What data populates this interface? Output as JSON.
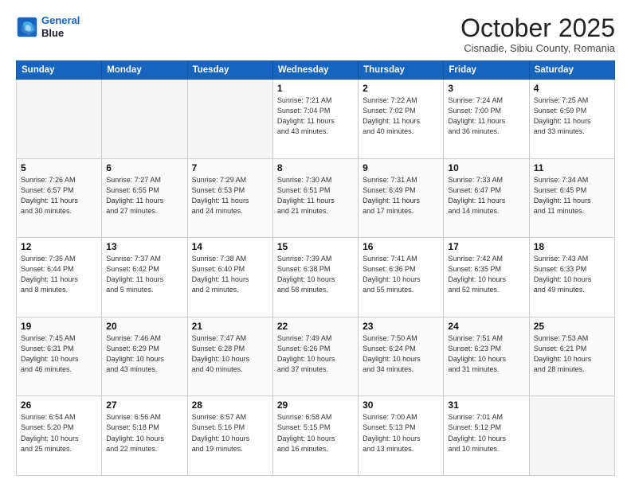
{
  "header": {
    "logo_line1": "General",
    "logo_line2": "Blue",
    "month": "October 2025",
    "location": "Cisnadie, Sibiu County, Romania"
  },
  "weekdays": [
    "Sunday",
    "Monday",
    "Tuesday",
    "Wednesday",
    "Thursday",
    "Friday",
    "Saturday"
  ],
  "weeks": [
    [
      {
        "day": "",
        "info": ""
      },
      {
        "day": "",
        "info": ""
      },
      {
        "day": "",
        "info": ""
      },
      {
        "day": "1",
        "info": "Sunrise: 7:21 AM\nSunset: 7:04 PM\nDaylight: 11 hours\nand 43 minutes."
      },
      {
        "day": "2",
        "info": "Sunrise: 7:22 AM\nSunset: 7:02 PM\nDaylight: 11 hours\nand 40 minutes."
      },
      {
        "day": "3",
        "info": "Sunrise: 7:24 AM\nSunset: 7:00 PM\nDaylight: 11 hours\nand 36 minutes."
      },
      {
        "day": "4",
        "info": "Sunrise: 7:25 AM\nSunset: 6:59 PM\nDaylight: 11 hours\nand 33 minutes."
      }
    ],
    [
      {
        "day": "5",
        "info": "Sunrise: 7:26 AM\nSunset: 6:57 PM\nDaylight: 11 hours\nand 30 minutes."
      },
      {
        "day": "6",
        "info": "Sunrise: 7:27 AM\nSunset: 6:55 PM\nDaylight: 11 hours\nand 27 minutes."
      },
      {
        "day": "7",
        "info": "Sunrise: 7:29 AM\nSunset: 6:53 PM\nDaylight: 11 hours\nand 24 minutes."
      },
      {
        "day": "8",
        "info": "Sunrise: 7:30 AM\nSunset: 6:51 PM\nDaylight: 11 hours\nand 21 minutes."
      },
      {
        "day": "9",
        "info": "Sunrise: 7:31 AM\nSunset: 6:49 PM\nDaylight: 11 hours\nand 17 minutes."
      },
      {
        "day": "10",
        "info": "Sunrise: 7:33 AM\nSunset: 6:47 PM\nDaylight: 11 hours\nand 14 minutes."
      },
      {
        "day": "11",
        "info": "Sunrise: 7:34 AM\nSunset: 6:45 PM\nDaylight: 11 hours\nand 11 minutes."
      }
    ],
    [
      {
        "day": "12",
        "info": "Sunrise: 7:35 AM\nSunset: 6:44 PM\nDaylight: 11 hours\nand 8 minutes."
      },
      {
        "day": "13",
        "info": "Sunrise: 7:37 AM\nSunset: 6:42 PM\nDaylight: 11 hours\nand 5 minutes."
      },
      {
        "day": "14",
        "info": "Sunrise: 7:38 AM\nSunset: 6:40 PM\nDaylight: 11 hours\nand 2 minutes."
      },
      {
        "day": "15",
        "info": "Sunrise: 7:39 AM\nSunset: 6:38 PM\nDaylight: 10 hours\nand 58 minutes."
      },
      {
        "day": "16",
        "info": "Sunrise: 7:41 AM\nSunset: 6:36 PM\nDaylight: 10 hours\nand 55 minutes."
      },
      {
        "day": "17",
        "info": "Sunrise: 7:42 AM\nSunset: 6:35 PM\nDaylight: 10 hours\nand 52 minutes."
      },
      {
        "day": "18",
        "info": "Sunrise: 7:43 AM\nSunset: 6:33 PM\nDaylight: 10 hours\nand 49 minutes."
      }
    ],
    [
      {
        "day": "19",
        "info": "Sunrise: 7:45 AM\nSunset: 6:31 PM\nDaylight: 10 hours\nand 46 minutes."
      },
      {
        "day": "20",
        "info": "Sunrise: 7:46 AM\nSunset: 6:29 PM\nDaylight: 10 hours\nand 43 minutes."
      },
      {
        "day": "21",
        "info": "Sunrise: 7:47 AM\nSunset: 6:28 PM\nDaylight: 10 hours\nand 40 minutes."
      },
      {
        "day": "22",
        "info": "Sunrise: 7:49 AM\nSunset: 6:26 PM\nDaylight: 10 hours\nand 37 minutes."
      },
      {
        "day": "23",
        "info": "Sunrise: 7:50 AM\nSunset: 6:24 PM\nDaylight: 10 hours\nand 34 minutes."
      },
      {
        "day": "24",
        "info": "Sunrise: 7:51 AM\nSunset: 6:23 PM\nDaylight: 10 hours\nand 31 minutes."
      },
      {
        "day": "25",
        "info": "Sunrise: 7:53 AM\nSunset: 6:21 PM\nDaylight: 10 hours\nand 28 minutes."
      }
    ],
    [
      {
        "day": "26",
        "info": "Sunrise: 6:54 AM\nSunset: 5:20 PM\nDaylight: 10 hours\nand 25 minutes."
      },
      {
        "day": "27",
        "info": "Sunrise: 6:56 AM\nSunset: 5:18 PM\nDaylight: 10 hours\nand 22 minutes."
      },
      {
        "day": "28",
        "info": "Sunrise: 6:57 AM\nSunset: 5:16 PM\nDaylight: 10 hours\nand 19 minutes."
      },
      {
        "day": "29",
        "info": "Sunrise: 6:58 AM\nSunset: 5:15 PM\nDaylight: 10 hours\nand 16 minutes."
      },
      {
        "day": "30",
        "info": "Sunrise: 7:00 AM\nSunset: 5:13 PM\nDaylight: 10 hours\nand 13 minutes."
      },
      {
        "day": "31",
        "info": "Sunrise: 7:01 AM\nSunset: 5:12 PM\nDaylight: 10 hours\nand 10 minutes."
      },
      {
        "day": "",
        "info": ""
      }
    ]
  ]
}
